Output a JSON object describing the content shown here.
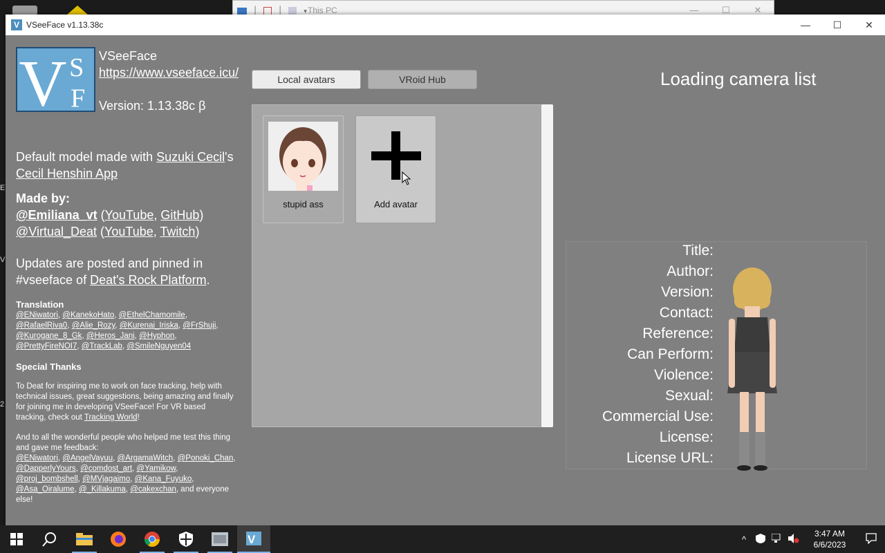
{
  "background_window": {
    "title": "This PC",
    "minimize": "—",
    "maximize": "☐",
    "close": "✕"
  },
  "window": {
    "title": "VSeeFace v1.13.38c",
    "icon_letter": "V",
    "minimize": "—",
    "maximize": "☐",
    "close": "✕"
  },
  "info": {
    "logo_text": "VSF",
    "app_name": "VSeeFace",
    "url": "https://www.vseeface.icu/",
    "version": "Version: 1.13.38c β",
    "default_model": {
      "prefix": "Default model made with ",
      "author_link": "Suzuki Cecil",
      "mid": "'s ",
      "app_link": "Cecil Henshin App"
    },
    "made_by": {
      "heading": "Made by:",
      "dev1": "@Emiliana_vt",
      "dev1_links": [
        "YouTube",
        "GitHub"
      ],
      "dev2": "@Virtual_Deat",
      "dev2_links": [
        "YouTube",
        "Twitch"
      ]
    },
    "updates": {
      "prefix": "Updates are posted and pinned in #vseeface of ",
      "link": "Deat's Rock Platform",
      "suffix": "."
    },
    "translation": {
      "heading": "Translation",
      "names": [
        "@ENiwatori",
        "@KanekoHato",
        "@EthelChamomile",
        "@RafaelRiva0",
        "@Alie_Rozy",
        "@Kurenai_Iriska",
        "@FrShuji",
        "@Kurogane_8_Gk",
        "@Heros_Jani",
        "@Hyphon",
        "@PrettyFireNOI7",
        "@TrackLab",
        "@SmileNguyen04"
      ]
    },
    "thanks": {
      "heading": "Special Thanks",
      "para1": "To Deat for inspiring me to work on face tracking, help with technical issues, great suggestions, being amazing and finally for joining me in developing VSeeFace! For VR based tracking, check out ",
      "para1_link": "Tracking World",
      "para1_suffix": "!",
      "para2": "And to all the wonderful people who helped me test this thing and gave me feedback:",
      "names": [
        "@ENiwatori",
        "@AngelVayuu",
        "@ArgamaWitch",
        "@Ponoki_Chan",
        "@DapperlyYours",
        "@comdost_art",
        "@Yamikow",
        "@proj_bombshell",
        "@MVjagaimo",
        "@Kana_Fuyuko",
        "@Asa_Oiralume",
        "@_Killakuma",
        "@cakexchan"
      ],
      "closing": ", and everyone else!"
    }
  },
  "tabs": {
    "local": "Local avatars",
    "vroid": "VRoid Hub"
  },
  "avatars": [
    {
      "label": "stupid ass"
    },
    {
      "label": "Add avatar",
      "icon": "plus-icon"
    }
  ],
  "camera_status": "Loading camera list",
  "metadata_labels": [
    "Title:",
    "Author:",
    "Version:",
    "Contact:",
    "Reference:",
    "Can Perform:",
    "Violence:",
    "Sexual:",
    "Commercial Use:",
    "License:",
    "License URL:"
  ],
  "taskbar": {
    "items": [
      "start-icon",
      "search-icon",
      "file-explorer-icon",
      "firefox-icon",
      "chrome-icon",
      "security-icon",
      "app-icon",
      "vseeface-icon"
    ],
    "time": "3:47 AM",
    "date": "6/6/2023",
    "tray_chevron": "^"
  },
  "colors": {
    "window_bg": "#7e7e7e",
    "avatar_panel": "#a6a6a6",
    "logo_blue": "#6aa9d3",
    "taskbar": "#1f1f1f",
    "accent": "#7fb5ea"
  }
}
